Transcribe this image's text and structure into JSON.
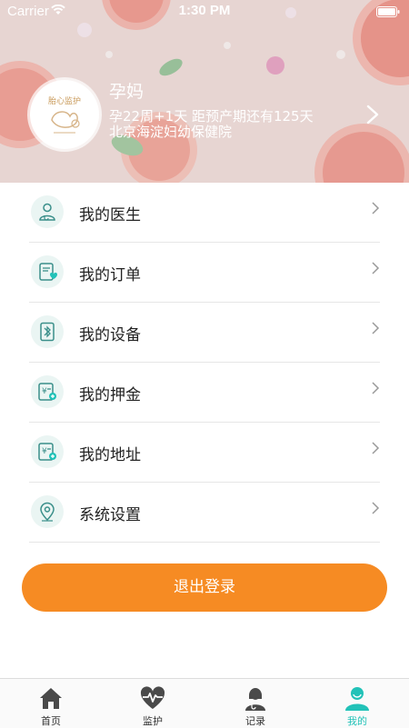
{
  "status_bar": {
    "carrier": "Carrier",
    "time": "1:30 PM"
  },
  "profile": {
    "name": "孕妈",
    "avatar_text": "胎心监护",
    "pregnancy": "孕22周+1天  距预产期还有125天",
    "hospital": "北京海淀妇幼保健院"
  },
  "menu": [
    {
      "label": "我的医生",
      "icon": "doctor-icon"
    },
    {
      "label": "我的订单",
      "icon": "order-icon"
    },
    {
      "label": "我的设备",
      "icon": "bluetooth-device-icon"
    },
    {
      "label": "我的押金",
      "icon": "deposit-icon"
    },
    {
      "label": "我的地址",
      "icon": "address-icon"
    },
    {
      "label": "系统设置",
      "icon": "location-pin-icon"
    }
  ],
  "logout_label": "退出登录",
  "tabs": [
    {
      "label": "首页",
      "icon": "home-icon"
    },
    {
      "label": "监护",
      "icon": "heartbeat-icon"
    },
    {
      "label": "记录",
      "icon": "nurse-icon"
    },
    {
      "label": "我的",
      "icon": "user-icon",
      "active": true
    }
  ],
  "colors": {
    "accent": "#22c2b8",
    "logout": "#f68b23",
    "icon_bg": "#eaf5f3"
  }
}
